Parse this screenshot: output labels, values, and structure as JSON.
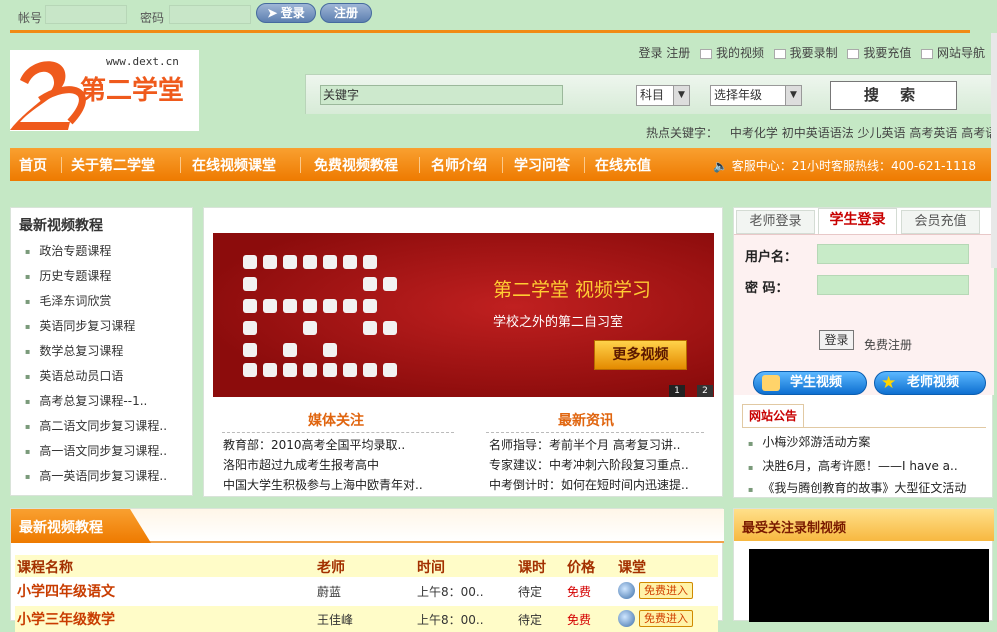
{
  "topbar": {
    "account_label": "帐号",
    "password_label": "密码",
    "login_btn": "登录",
    "register_btn": "注册"
  },
  "header": {
    "logo_url_text": "www.dext.cn",
    "logo_text": "第二学堂",
    "toplinks": {
      "login": "登录",
      "register": "注册",
      "my_video": "我的视频",
      "record": "我要录制",
      "recharge": "我要充值",
      "site_nav": "网站导航"
    },
    "search": {
      "placeholder": "关键字",
      "subject": "科目",
      "grade": "选择年级",
      "button": "搜 索"
    },
    "hot_keywords_label": "热点关键字：",
    "hot_keywords": [
      "中考化学",
      "初中英语语法",
      "少儿英语",
      "高考英语",
      "高考语"
    ]
  },
  "nav": {
    "items": [
      "首页",
      "关于第二学堂",
      "在线视频课堂",
      "免费视频教程",
      "名师介绍",
      "学习问答",
      "在线充值"
    ],
    "hotline": "客服中心：21小时客服热线：400-621-1118"
  },
  "left": {
    "title": "最新视频教程",
    "items": [
      "政治专题课程",
      "历史专题课程",
      "毛泽东词欣赏",
      "英语同步复习课程",
      "数学总复习课程",
      "英语总动员口语",
      "高考总复习课程--1..",
      "高二语文同步复习课程..",
      "高一语文同步复习课程..",
      "高一英语同步复习课程.."
    ]
  },
  "banner": {
    "title": "第二学堂 视频学习",
    "subtitle": "学校之外的第二自习室",
    "more_btn": "更多视频",
    "pages": [
      "1",
      "2"
    ]
  },
  "media": {
    "title": "媒体关注",
    "items": [
      "教育部：2010高考全国平均录取..",
      "洛阳市超过九成考生报考高中",
      "中国大学生积极参与上海中欧青年对.."
    ]
  },
  "news": {
    "title": "最新资讯",
    "items": [
      "名师指导：考前半个月 高考复习讲..",
      "专家建议：中考冲刺六阶段复习重点..",
      "中考倒计时：如何在短时间内迅速提.."
    ]
  },
  "right": {
    "tabs": [
      "老师登录",
      "学生登录",
      "会员充值"
    ],
    "username_label": "用户名：",
    "password_label": "密 码：",
    "login_btn": "登录",
    "register": "免费注册",
    "student_video": "学生视频",
    "teacher_video": "老师视频",
    "notice_title": "网站公告",
    "notices": [
      "小梅沙郊游活动方案",
      "决胜6月，高考许愿！——I have a..",
      "《我与腾创教育的故事》大型征文活动"
    ]
  },
  "bottom": {
    "title": "最新视频教程",
    "columns": [
      "课程名称",
      "老师",
      "时间",
      "课时",
      "价格",
      "课堂"
    ],
    "rows": [
      {
        "name": "小学四年级语文",
        "teacher": "蔚蓝",
        "time": "上午8：00..",
        "hours": "待定",
        "price": "免费",
        "enter": "免费进入"
      },
      {
        "name": "小学三年级数学",
        "teacher": "王佳峰",
        "time": "上午8：00..",
        "hours": "待定",
        "price": "免费",
        "enter": "免费进入"
      }
    ],
    "side_title": "最受关注录制视频"
  },
  "colors": {
    "accent": "#ee7a00",
    "background": "#c5e8c5",
    "red": "#c80000"
  }
}
